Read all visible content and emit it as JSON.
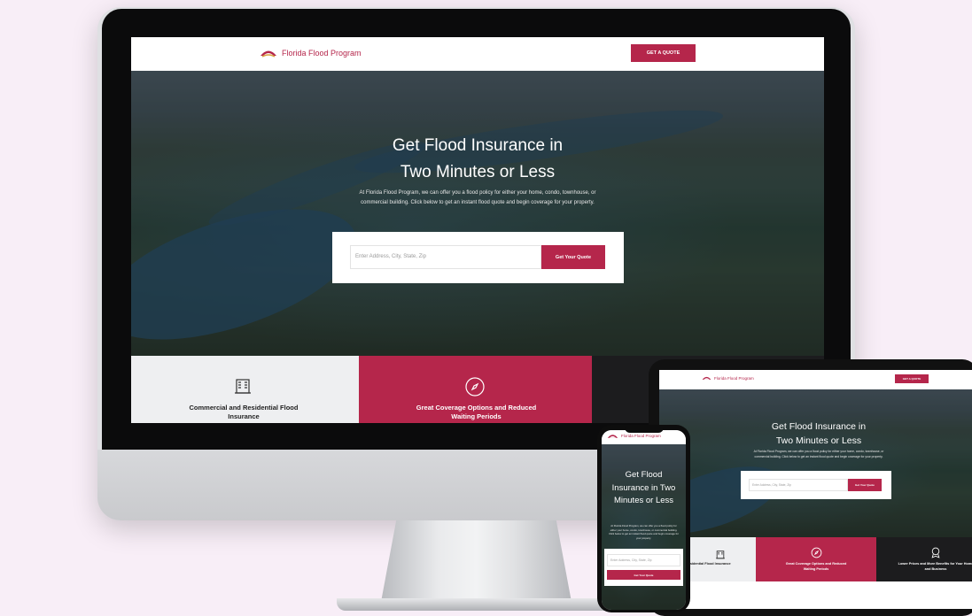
{
  "brand": {
    "name": "Florida Flood Program",
    "accent": "#b5264b",
    "dark": "#1c1c1e",
    "light": "#eeeff1"
  },
  "nav": {
    "cta": "GET A QUOTE"
  },
  "hero": {
    "title_line1": "Get Flood Insurance in",
    "title_line2": "Two Minutes or Less",
    "mobile_title": "Get Flood Insurance in Two Minutes or Less",
    "description": "At Florida Flood Program, we can offer you a flood policy for either your home, condo, townhouse, or commercial building. Click below to get an instant flood quote and begin coverage for your property."
  },
  "search": {
    "placeholder": "Enter Address, City, State, Zip",
    "button": "Get Your Quote"
  },
  "features": [
    {
      "icon": "building-icon",
      "label": "Commercial and Residential Flood Insurance"
    },
    {
      "icon": "compass-icon",
      "label": "Great Coverage Options and Reduced Waiting Periods"
    },
    {
      "icon": "award-icon",
      "label": "Lower Prices and More Benefits for Your Home and Business"
    }
  ]
}
